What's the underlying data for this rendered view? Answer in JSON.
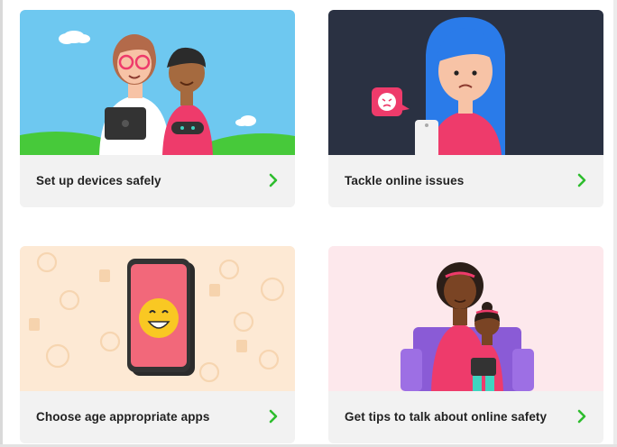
{
  "cards": [
    {
      "label": "Set up devices safely",
      "icon": "chevron-right-icon"
    },
    {
      "label": "Tackle online issues",
      "icon": "chevron-right-icon"
    },
    {
      "label": "Choose age appropriate apps",
      "icon": "chevron-right-icon"
    },
    {
      "label": "Get tips to talk about online safety",
      "icon": "chevron-right-icon"
    }
  ],
  "colors": {
    "accent_chevron": "#2ebd2e",
    "card_footer": "#f2f2f2",
    "sky": "#6ec8f0",
    "dark_panel": "#2a3142",
    "peach_panel": "#fde9d4",
    "pink_panel": "#fde8ec"
  }
}
